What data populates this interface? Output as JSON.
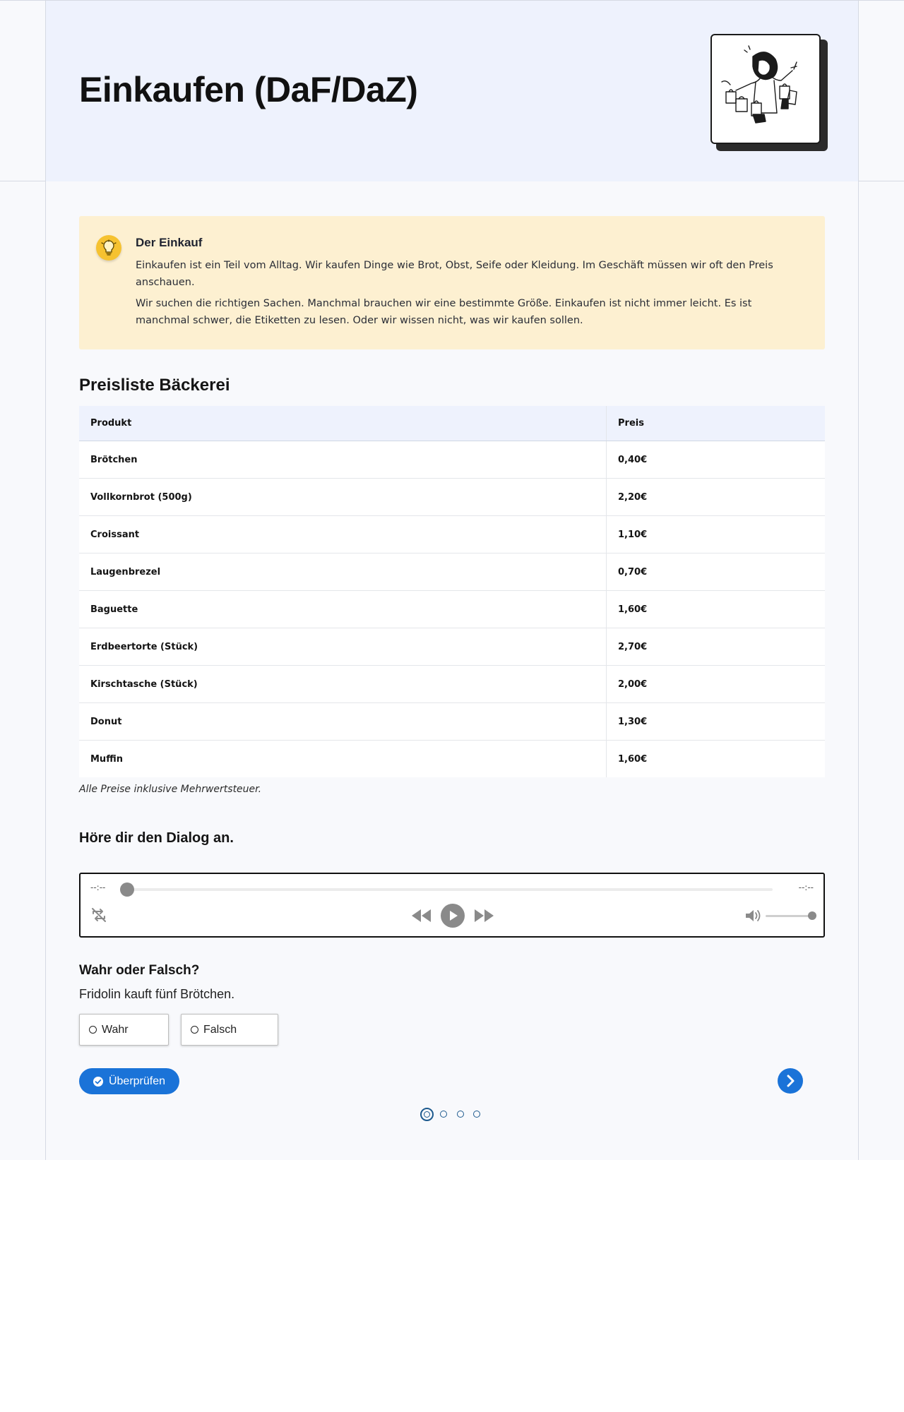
{
  "header": {
    "title": "Einkaufen (DaF/DaZ)",
    "illustration_icon": "shopping-woman-with-bags-icon"
  },
  "info": {
    "icon": "lightbulb-icon",
    "title": "Der Einkauf",
    "paragraph1": "Einkaufen ist ein Teil vom Alltag. Wir kaufen Dinge wie Brot, Obst, Seife oder Kleidung. Im Geschäft müssen wir oft den Preis anschauen.",
    "paragraph2": "Wir suchen die richtigen Sachen. Manchmal brauchen wir eine bestimmte Größe. Einkaufen ist nicht immer leicht. Es ist manchmal schwer, die Etiketten zu lesen. Oder wir wissen nicht, was wir kaufen sollen."
  },
  "price_table": {
    "title": "Preisliste Bäckerei",
    "columns": [
      "Produkt",
      "Preis"
    ],
    "rows": [
      [
        "Brötchen",
        "0,40€"
      ],
      [
        "Vollkornbrot (500g)",
        "2,20€"
      ],
      [
        "Croissant",
        "1,10€"
      ],
      [
        "Laugenbrezel",
        "0,70€"
      ],
      [
        "Baguette",
        "1,60€"
      ],
      [
        "Erdbeertorte (Stück)",
        "2,70€"
      ],
      [
        "Kirschtasche (Stück)",
        "2,00€"
      ],
      [
        "Donut",
        "1,30€"
      ],
      [
        "Muffin",
        "1,60€"
      ]
    ],
    "note": "Alle Preise inklusive Mehrwertsteuer."
  },
  "audio": {
    "title": "Höre dir den Dialog an.",
    "current_time": "--:--",
    "total_time": "--:--",
    "progress": 0,
    "volume": 1,
    "icons": {
      "loop": "loop-off-icon",
      "rewind": "rewind-icon",
      "play": "play-icon",
      "forward": "fast-forward-icon",
      "volume": "volume-icon"
    }
  },
  "quiz": {
    "title": "Wahr oder Falsch?",
    "statement": "Fridolin kauft fünf Brötchen.",
    "options": [
      "Wahr",
      "Falsch"
    ],
    "check_label": "Überprüfen",
    "next_icon": "chevron-right-icon",
    "pages_total": 4,
    "current_page": 1
  },
  "colors": {
    "accent": "#1a73d8",
    "hero_bg": "#eef2fd",
    "info_bg": "#fdf0d1",
    "info_icon": "#f6c230",
    "pager": "#1d5a8e"
  }
}
